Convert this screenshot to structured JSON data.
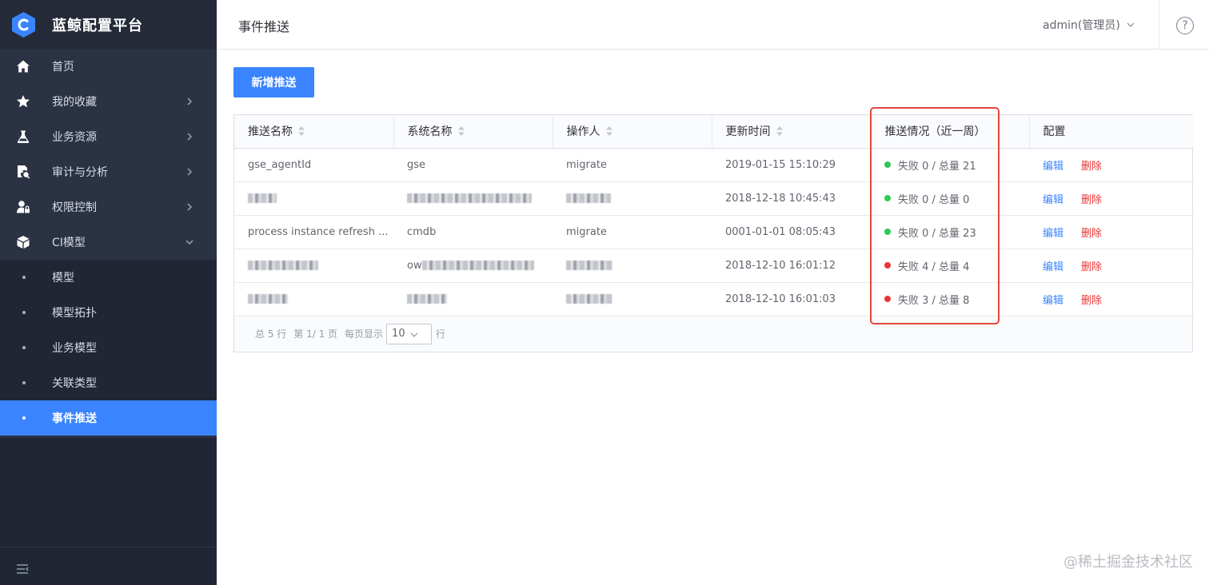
{
  "app": {
    "name": "蓝鲸配置平台"
  },
  "sidebar": {
    "items": [
      {
        "label": "首页",
        "icon": "home-icon",
        "has_children": false
      },
      {
        "label": "我的收藏",
        "icon": "star-icon",
        "has_children": true
      },
      {
        "label": "业务资源",
        "icon": "flask-icon",
        "has_children": true
      },
      {
        "label": "审计与分析",
        "icon": "audit-doc-icon",
        "has_children": true
      },
      {
        "label": "权限控制",
        "icon": "user-lock-icon",
        "has_children": true
      },
      {
        "label": "CI模型",
        "icon": "cube-icon",
        "has_children": true,
        "expanded": true
      }
    ],
    "sub_items": [
      {
        "label": "模型"
      },
      {
        "label": "模型拓扑"
      },
      {
        "label": "业务模型"
      },
      {
        "label": "关联类型"
      },
      {
        "label": "事件推送",
        "active": true
      }
    ]
  },
  "header": {
    "title": "事件推送",
    "user": "admin(管理员)",
    "help_glyph": "?"
  },
  "toolbar": {
    "add_label": "新增推送"
  },
  "table": {
    "columns": [
      {
        "label": "推送名称",
        "sortable": true
      },
      {
        "label": "系统名称",
        "sortable": true
      },
      {
        "label": "操作人",
        "sortable": true
      },
      {
        "label": "更新时间",
        "sortable": true
      },
      {
        "label": "推送情况（近一周）",
        "sortable": false
      },
      {
        "label": "配置",
        "sortable": false
      }
    ],
    "rows": [
      {
        "name": "gse_agentId",
        "system": "gse",
        "operator": "migrate",
        "updated": "2019-01-15 15:10:29",
        "status_text": "失败 0 / 总量 21",
        "status": "success"
      },
      {
        "name": "",
        "system": "",
        "operator": "",
        "updated": "2018-12-18 10:45:43",
        "status_text": "失败 0 / 总量 0",
        "status": "success"
      },
      {
        "name": "process instance refresh ...",
        "system": "cmdb",
        "operator": "migrate",
        "updated": "0001-01-01 08:05:43",
        "status_text": "失败 0 / 总量 23",
        "status": "success"
      },
      {
        "name": "",
        "system": "ow",
        "operator": "",
        "updated": "2018-12-10 16:01:12",
        "status_text": "失败 4 / 总量 4",
        "status": "fail"
      },
      {
        "name": "",
        "system": "",
        "operator": "",
        "updated": "2018-12-10 16:01:03",
        "status_text": "失败 3 / 总量 8",
        "status": "fail"
      }
    ],
    "edit_label": "编辑",
    "delete_label": "删除"
  },
  "pagination": {
    "total_text": "总 5 行",
    "page_text": "第 1/ 1 页",
    "per_page_label": "每页显示",
    "per_page_value": "10",
    "rows_suffix": "行"
  },
  "watermark": "@稀土掘金技术社区",
  "colors": {
    "sidebar_bg": "#2b3243",
    "accent": "#3a84ff",
    "success_dot": "#2dcb56",
    "fail_dot": "#ea3636",
    "highlight_border": "#e2463c"
  }
}
